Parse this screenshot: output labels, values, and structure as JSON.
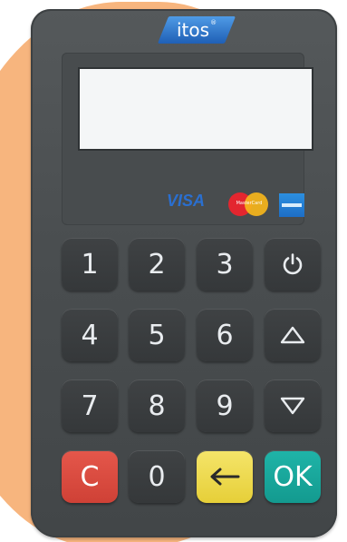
{
  "logo": {
    "text": "itos",
    "reg": "®"
  },
  "card_brands": {
    "visa": "VISA",
    "mastercard": "MasterCard"
  },
  "keypad": {
    "row1": [
      "1",
      "2",
      "3"
    ],
    "row2": [
      "4",
      "5",
      "6"
    ],
    "row3": [
      "7",
      "8",
      "9"
    ],
    "row4": {
      "cancel": "C",
      "zero": "0",
      "ok": "OK"
    },
    "icons": {
      "power": "power-icon",
      "up": "triangle-up-icon",
      "down": "triangle-down-icon",
      "back": "arrow-left-icon"
    }
  },
  "colors": {
    "background_blob": "#f7b57e",
    "device_body": "#4a4e50",
    "key_dark": "#3a3d3f",
    "key_cancel": "#d9493e",
    "key_back": "#eedb4f",
    "key_ok": "#18a89c",
    "logo_blue": "#2f7ad2"
  }
}
